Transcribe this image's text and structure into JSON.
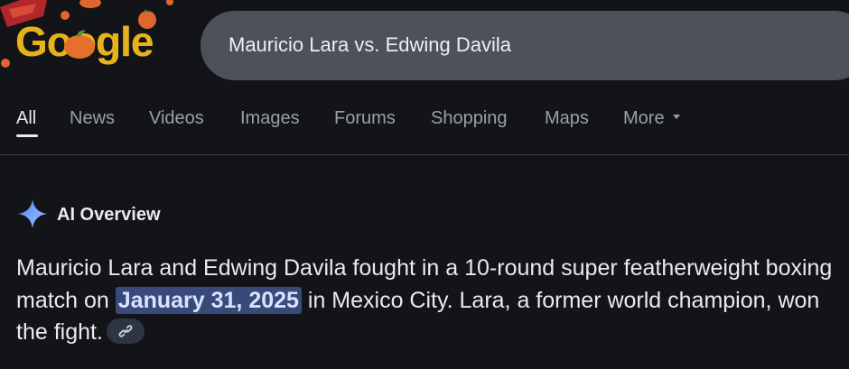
{
  "logo": {
    "text": "Google"
  },
  "search": {
    "query": "Mauricio Lara vs. Edwing Davila"
  },
  "tabs": [
    {
      "label": "All",
      "active": true
    },
    {
      "label": "News"
    },
    {
      "label": "Videos"
    },
    {
      "label": "Images"
    },
    {
      "label": "Forums"
    },
    {
      "label": "Shopping"
    },
    {
      "label": "Maps"
    },
    {
      "label": "More"
    }
  ],
  "ai_overview": {
    "title": "AI Overview",
    "text_before": "Mauricio Lara and Edwing Davila fought in a 10-round super featherweight boxing match on ",
    "highlight": "January 31, 2025",
    "text_after": " in Mexico City. Lara, a former world champion, won the fight."
  },
  "colors": {
    "background": "#131418",
    "search_bar": "#4d5159",
    "highlight_bg": "#394a7a",
    "logo": "#e6b21e",
    "sparkle": "#6fa4f5"
  },
  "icons": {
    "sparkle": "ai-sparkle-icon",
    "link": "link-icon",
    "more_caret": "caret-down-icon"
  }
}
